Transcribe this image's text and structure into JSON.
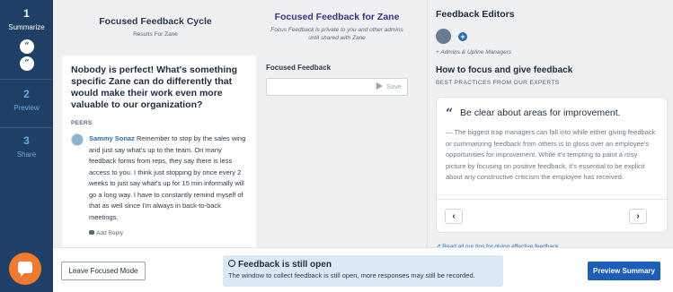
{
  "steps": [
    {
      "num": "1",
      "label": "Summarize",
      "active": true
    },
    {
      "num": "2",
      "label": "Preview",
      "active": false
    },
    {
      "num": "3",
      "label": "Share",
      "active": false
    }
  ],
  "rail_bubbles": [
    "“",
    "“"
  ],
  "cycle": {
    "title": "Focused Feedback Cycle",
    "subtitle": "Results For Zane"
  },
  "focus": {
    "title": "Focused Feedback for Zane",
    "subtitle": "Focus Feedback is private to you and other admins until shared with Zane",
    "section_label": "Focused Feedback",
    "input_value": "",
    "save_label": "Save"
  },
  "question": "Nobody is perfect! What's something specific Zane can do differently that would make their work even more valuable to our organization?",
  "peers_label": "PEERS",
  "comment": {
    "author": "Sammy Sonaz",
    "text": "Remember to stop by the sales wing and just say what's up to the team. On many feedback forms from reps, they say there is less access to you. I think just stopping by once every 2 weeks to just say what's up for 15 min informally will go a long way. I have to constantly remind myself of that as well since I'm always in back-to-back meetings.",
    "reply_label": "Add Reply"
  },
  "editors": {
    "title": "Feedback Editors",
    "plus": "+",
    "managers_label": "+ Admins & Upline Managers"
  },
  "tips": {
    "title": "How to focus and give feedback",
    "subtitle": "BEST PRACTICES FROM OUR EXPERTS",
    "quote_mark": "“",
    "card_title": "Be clear about areas for improvement.",
    "card_body": "— The biggest trap managers can fall into while either giving feedback or summarizing feedback from others is to gloss over an employee's opportunities for improvement. While it's tempting to paint a rosy picture by focusing on positive feedback, it's essential to be explicit about any constructive criticism the employee has received.",
    "prev": "‹",
    "next": "›",
    "link_label": "Read all our tips for giving effective feedback"
  },
  "footer": {
    "leave_label": "Leave Focused Mode",
    "status_title": "Feedback is still open",
    "status_desc": "The window to collect feedback is still open, more responses may still be recorded.",
    "preview_label": "Preview Summary"
  },
  "colors": {
    "rail": "#1f3f66",
    "accent": "#1c5eb8",
    "focus_title": "#3a3480",
    "fab": "#f07b2e"
  }
}
